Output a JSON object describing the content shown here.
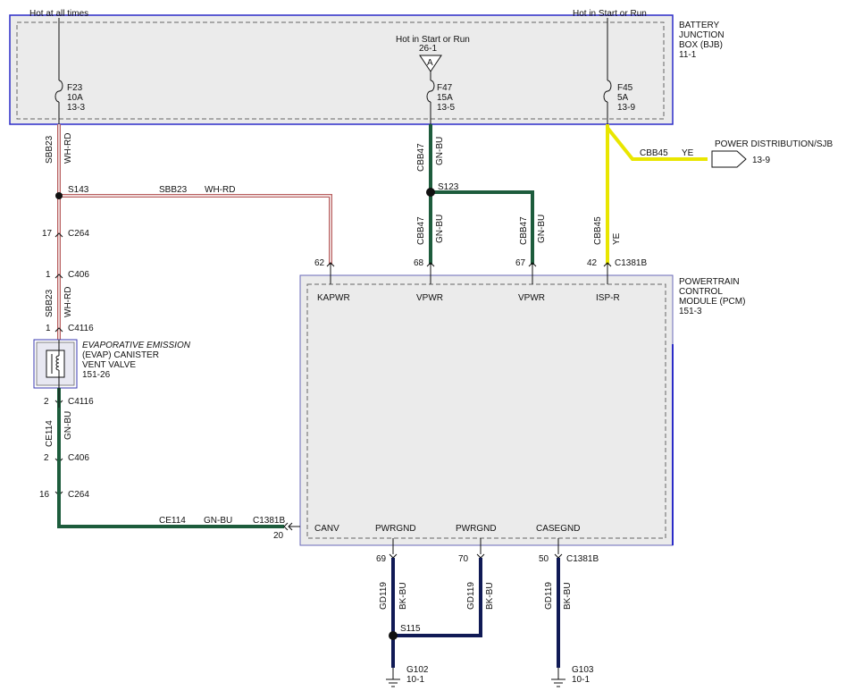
{
  "top_labels": {
    "left_feed": "Hot at all times",
    "right_feed": "Hot in Start or Run"
  },
  "bjb": {
    "title": [
      "BATTERY",
      "JUNCTION",
      "BOX (BJB)",
      "11-1"
    ],
    "inner_feed_label": "Hot in Start or Run",
    "inner_feed_ref": "26-1",
    "triangle_letter": "A",
    "fuses": [
      {
        "id": "F23",
        "rating": "10A",
        "ref": "13-3"
      },
      {
        "id": "F47",
        "rating": "15A",
        "ref": "13-5"
      },
      {
        "id": "F45",
        "rating": "5A",
        "ref": "13-9"
      }
    ]
  },
  "pcm": {
    "title": [
      "POWERTRAIN",
      "CONTROL",
      "MODULE (PCM)",
      "151-3"
    ],
    "pins": [
      "KAPWR",
      "VPWR",
      "VPWR",
      "ISP-R",
      "CANV",
      "PWRGND",
      "PWRGND",
      "CASEGND"
    ],
    "pin_numbers": [
      "62",
      "68",
      "67",
      "42",
      "20",
      "69",
      "70",
      "50"
    ],
    "connector": "C1381B"
  },
  "evap": {
    "title": [
      "EVAPORATIVE EMISSION",
      "(EVAP) CANISTER",
      "VENT VALVE",
      "151-26"
    ]
  },
  "power_dist": {
    "label": "POWER DISTRIBUTION/SJB",
    "ref": "13-9"
  },
  "left_connectors": [
    {
      "pin": "17",
      "name": "C264"
    },
    {
      "pin": "1",
      "name": "C406"
    },
    {
      "pin": "1",
      "name": "C4116"
    },
    {
      "pin": "2",
      "name": "C4116"
    },
    {
      "pin": "2",
      "name": "C406"
    },
    {
      "pin": "16",
      "name": "C264"
    }
  ],
  "splices": [
    "S143",
    "S123",
    "S115"
  ],
  "circuits": {
    "sbb23": "SBB23",
    "wh_rd": "WH-RD",
    "cbb47": "CBB47",
    "gn_bu": "GN-BU",
    "cbb45": "CBB45",
    "ye": "YE",
    "ce114": "CE114",
    "gd119": "GD119",
    "bk_bu": "BK-BU"
  },
  "grounds": [
    {
      "id": "G102",
      "ref": "10-1"
    },
    {
      "id": "G103",
      "ref": "10-1"
    }
  ],
  "colors": {
    "box_border": "#2b2bc8",
    "box_fill": "#ebebeb",
    "wh_rd": "#b86060",
    "gn_bu": "#1d5c3c",
    "ye": "#f4f000",
    "bk_bu": "#101a55",
    "dashed": "#555555"
  }
}
